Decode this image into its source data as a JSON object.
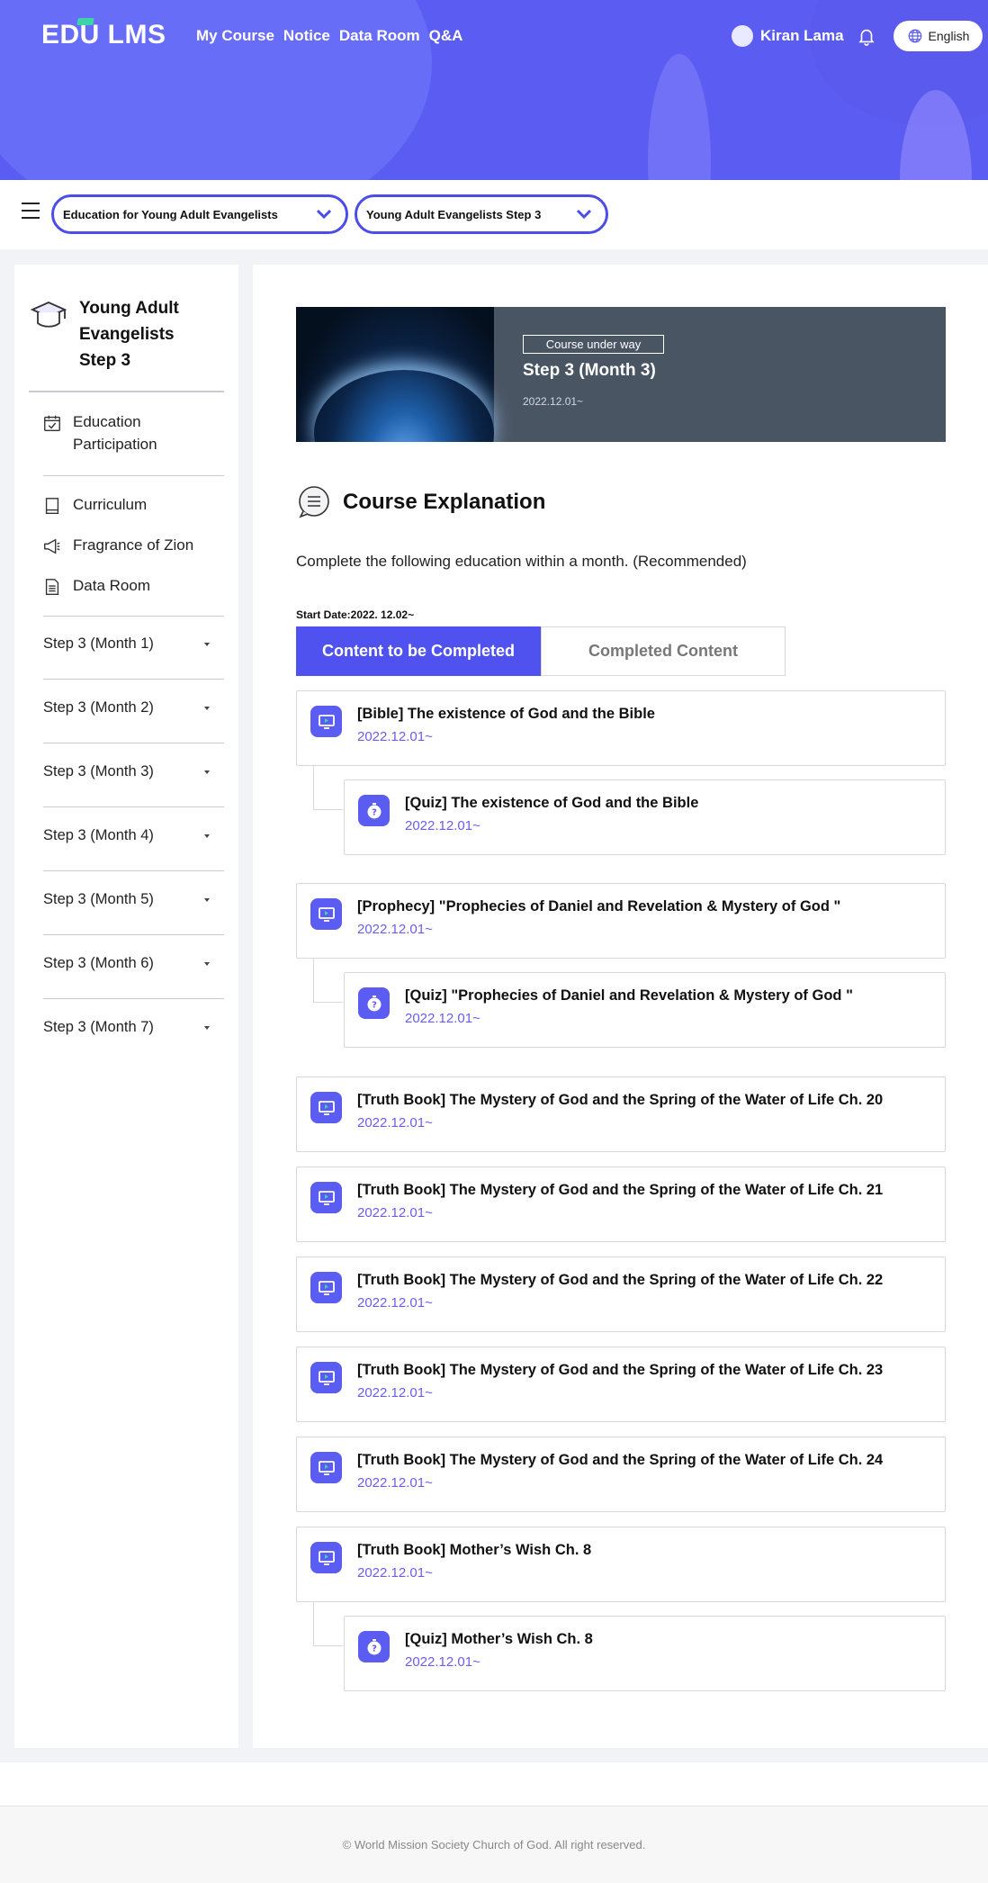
{
  "header": {
    "logo": "EDU LMS",
    "nav": [
      "My Course",
      "Notice",
      "Data Room",
      "Q&A"
    ],
    "user_name": "Kiran Lama",
    "language": "English"
  },
  "selectors": {
    "course": "Education for Young Adult Evangelists",
    "step": "Young Adult Evangelists Step 3"
  },
  "sidebar": {
    "title": "Young Adult Evangelists Step 3",
    "menu": [
      {
        "label": "Education Participation",
        "icon": "calendar-check-icon"
      },
      {
        "label": "Curriculum",
        "icon": "book-icon"
      },
      {
        "label": "Fragrance of Zion",
        "icon": "megaphone-icon"
      },
      {
        "label": "Data Room",
        "icon": "document-icon"
      }
    ],
    "steps": [
      "Step 3 (Month 1)",
      "Step 3 (Month 2)",
      "Step 3 (Month 3)",
      "Step 3 (Month 4)",
      "Step 3 (Month 5)",
      "Step 3 (Month 6)",
      "Step 3 (Month 7)"
    ]
  },
  "banner": {
    "badge": "Course under way",
    "title": "Step 3 (Month 3)",
    "date": "2022.12.01~"
  },
  "explanation": {
    "title": "Course Explanation",
    "text": "Complete the following education within a month. (Recommended)",
    "start_date": "Start Date:2022. 12.02~"
  },
  "tabs": {
    "active": "Content to be Completed",
    "inactive": "Completed Content"
  },
  "items": [
    {
      "type": "video",
      "title": "[Bible] The existence of God and the Bible",
      "date": "2022.12.01~"
    },
    {
      "type": "quiz",
      "title": "[Quiz] The existence of God and the Bible",
      "date": "2022.12.01~"
    },
    {
      "type": "video",
      "title": "[Prophecy] \"Prophecies of Daniel and Revelation & Mystery of God \"",
      "date": "2022.12.01~"
    },
    {
      "type": "quiz",
      "title": "[Quiz] \"Prophecies of Daniel and Revelation & Mystery of God \"",
      "date": "2022.12.01~"
    },
    {
      "type": "video",
      "title": "[Truth Book] The Mystery of God and the Spring of the Water of Life Ch. 20",
      "date": "2022.12.01~"
    },
    {
      "type": "video",
      "title": "[Truth Book] The Mystery of God and the Spring of the Water of Life Ch. 21",
      "date": "2022.12.01~"
    },
    {
      "type": "video",
      "title": "[Truth Book] The Mystery of God and the Spring of the Water of Life Ch. 22",
      "date": "2022.12.01~"
    },
    {
      "type": "video",
      "title": "[Truth Book] The Mystery of God and the Spring of the Water of Life Ch. 23",
      "date": "2022.12.01~"
    },
    {
      "type": "video",
      "title": "[Truth Book] The Mystery of God and the Spring of the Water of Life Ch. 24",
      "date": "2022.12.01~"
    },
    {
      "type": "video",
      "title": "[Truth Book] Mother’s Wish Ch. 8",
      "date": "2022.12.01~"
    },
    {
      "type": "quiz",
      "title": "[Quiz] Mother’s Wish Ch. 8",
      "date": "2022.12.01~"
    }
  ],
  "footer": "© World Mission Society Church of God. All right reserved.",
  "colors": {
    "brand": "#5b5cf2",
    "accent": "#5052f0",
    "date": "#6a5df0"
  }
}
